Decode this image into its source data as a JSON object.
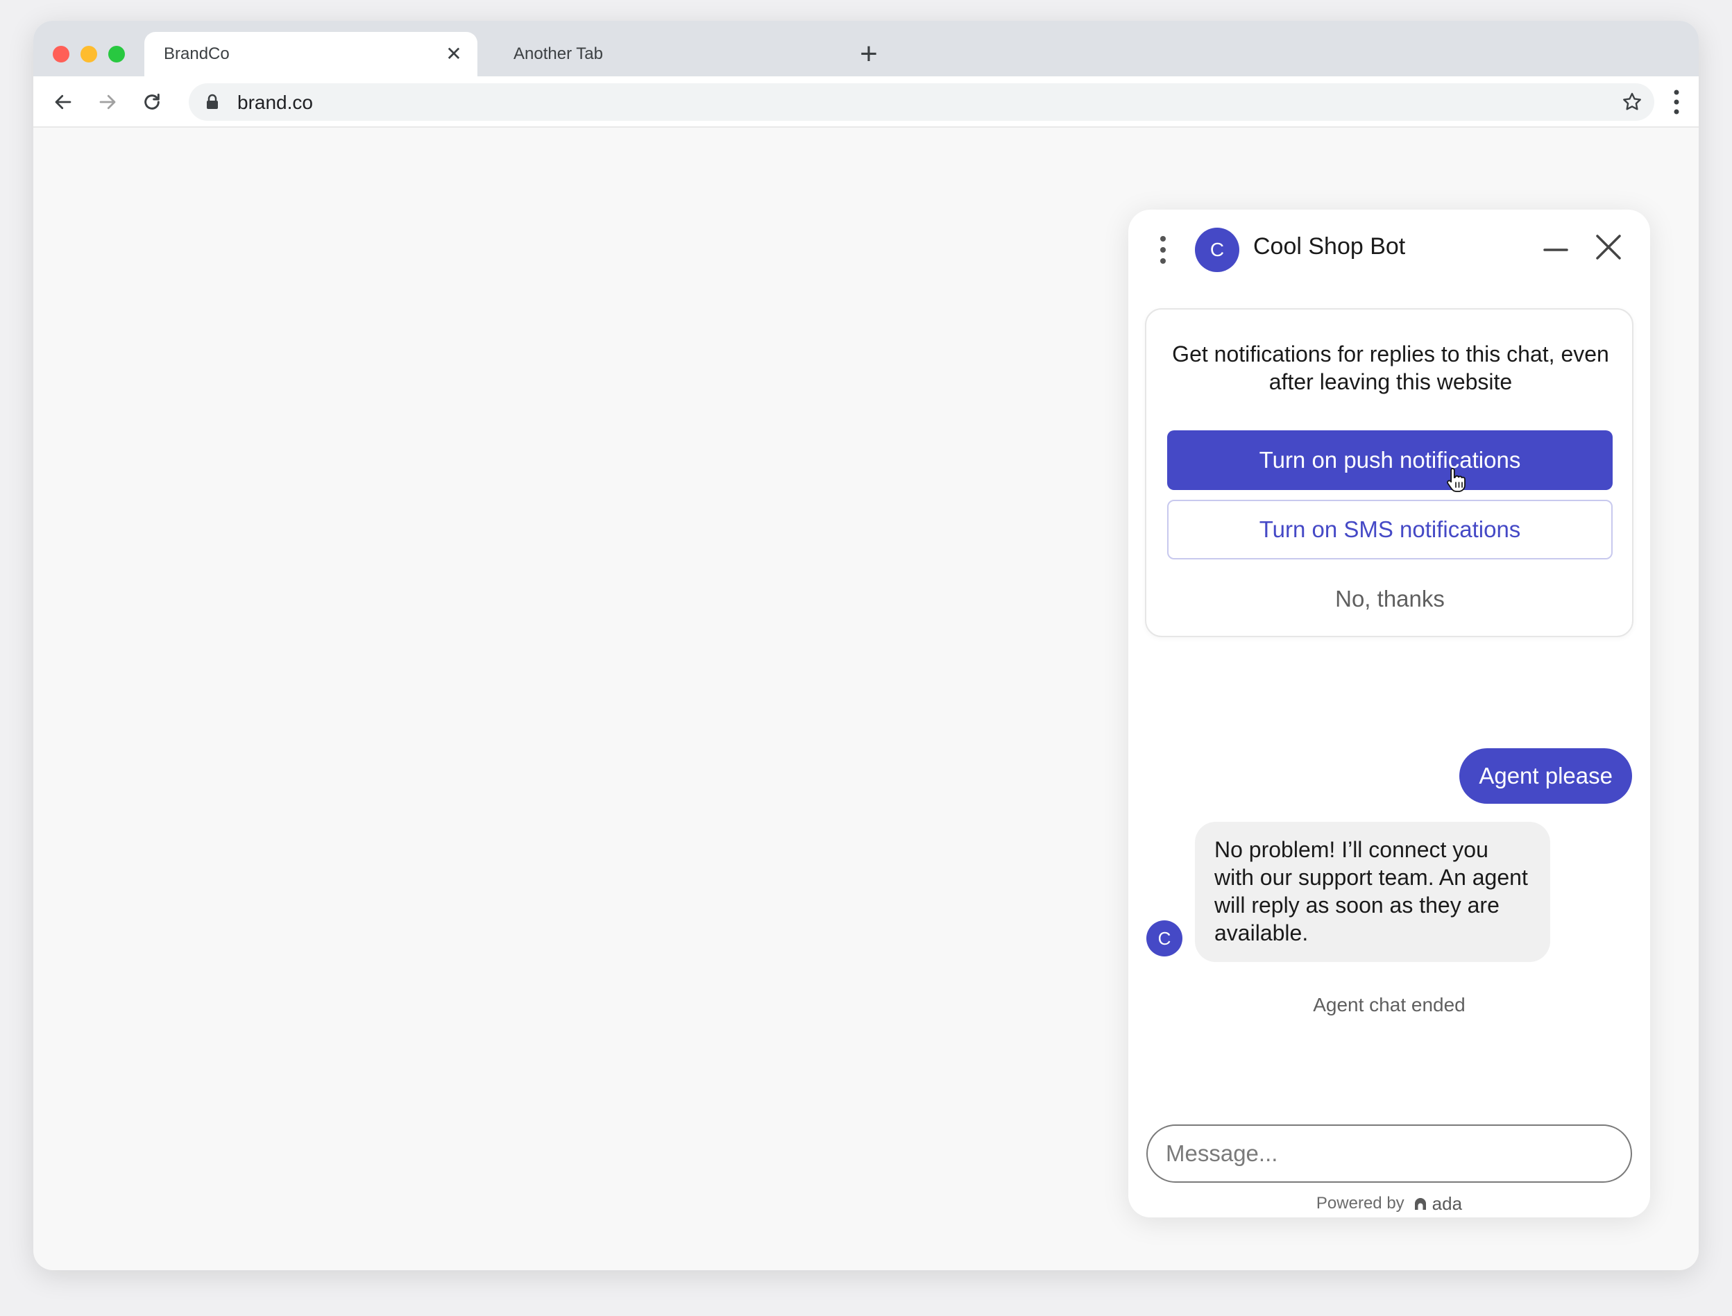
{
  "browser": {
    "tabs": [
      {
        "label": "BrandCo",
        "active": true
      },
      {
        "label": "Another Tab",
        "active": false
      }
    ],
    "tab_close_glyph": "✕",
    "new_tab_glyph": "+",
    "url": "brand.co"
  },
  "chat": {
    "bot_name": "Cool Shop Bot",
    "avatar_initial": "C",
    "notify": {
      "text": "Get notifications for replies to this chat, even after leaving this website",
      "push_label": "Turn on push notifications",
      "sms_label": "Turn on SMS notifications",
      "decline_label": "No, thanks"
    },
    "messages": [
      {
        "from": "user",
        "text": "Agent please"
      },
      {
        "from": "bot",
        "text": "No problem! I’ll connect you with our support team. An agent will reply as soon as they are available."
      }
    ],
    "system_note": "Agent chat ended",
    "input_placeholder": "Message...",
    "powered_by": "Powered by",
    "brand": "ada"
  },
  "colors": {
    "accent": "#4549c6",
    "bot_bubble": "#f0f0f0",
    "tabstrip": "#dee1e6"
  }
}
